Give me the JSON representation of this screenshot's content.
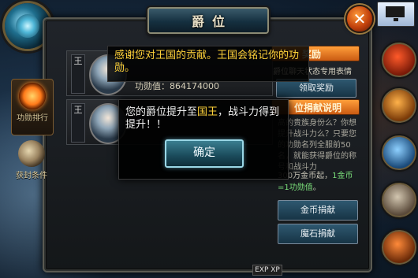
{
  "window": {
    "title": "爵位",
    "close_label": "✕"
  },
  "side_tabs": [
    {
      "label": "功勋排行",
      "icon": "sun-icon"
    },
    {
      "label": "获封条件",
      "icon": "beast-icon"
    }
  ],
  "ranking": {
    "rows": [
      {
        "tag": "王",
        "power_label": "功勋值：",
        "power_value": "864174000"
      },
      {
        "tag": "王",
        "power_label": "",
        "power_value": ""
      }
    ]
  },
  "chat": {
    "text": "感谢您对王国的贡献。王国会铭记你的功勋。"
  },
  "reward": {
    "head": "奖励",
    "desc": "爵位聊天状态专用表情",
    "claim_label": "领取奖励"
  },
  "donate": {
    "head": "位捐献说明",
    "faded_text": "高的贵族身份么？你想提升战斗力么？只要您的功勋名列全服前50名，就能获得爵位的称号和战斗力",
    "info_prefix": "300万金币起，",
    "info_hl": "1金币=1功勋值",
    "info_suffix": "。",
    "gold_label": "金币捐献",
    "stone_label": "魔石捐献"
  },
  "popup": {
    "msg_prefix": "您的爵位提升至",
    "msg_rank": "国王",
    "msg_suffix": "，战斗力得到提升！！",
    "confirm_label": "确定"
  },
  "bottom": {
    "exp_label": "EXP XP"
  },
  "colors": {
    "accent_orange": "#ff9f3a",
    "highlight_yellow": "#ffd23a",
    "button_blue": "#2e5870"
  }
}
